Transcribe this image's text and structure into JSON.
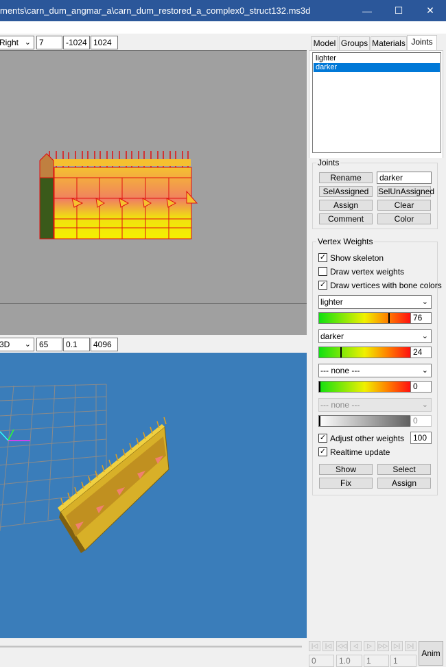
{
  "window": {
    "title": "ments\\carn_dum_angmar_a\\carn_dum_restored_a_complex0_struct132.ms3d",
    "minimize": "—",
    "maximize": "☐",
    "close": "✕"
  },
  "viewport_top": {
    "view": "Right",
    "field1": "7",
    "field2": "-1024",
    "field3": "1024"
  },
  "viewport_bottom": {
    "view": "3D",
    "field1": "65",
    "field2": "0.1",
    "field3": "4096"
  },
  "tabs": [
    "Model",
    "Groups",
    "Materials",
    "Joints"
  ],
  "selected_tab": "Joints",
  "joint_list": [
    "lighter",
    "darker"
  ],
  "selected_joint": "darker",
  "joints_group": {
    "title": "Joints",
    "rename": "Rename",
    "name_value": "darker",
    "sel_assigned": "SelAssigned",
    "sel_unassigned": "SelUnAssigned",
    "assign": "Assign",
    "clear": "Clear",
    "comment": "Comment",
    "color": "Color"
  },
  "vertex_weights": {
    "title": "Vertex Weights",
    "show_skeleton": "Show skeleton",
    "show_skeleton_checked": true,
    "draw_vertex_weights": "Draw vertex weights",
    "draw_vertex_weights_checked": false,
    "draw_vertices_bone_colors": "Draw vertices with bone colors",
    "draw_vertices_bone_colors_checked": true,
    "weights": [
      {
        "joint": "lighter",
        "value": "76",
        "level": 0.76,
        "enabled": true
      },
      {
        "joint": "darker",
        "value": "24",
        "level": 0.24,
        "enabled": true
      },
      {
        "joint": "--- none ---",
        "value": "0",
        "level": 0,
        "enabled": true
      },
      {
        "joint": "--- none ---",
        "value": "0",
        "level": 0,
        "enabled": false
      }
    ],
    "adjust_other_weights": "Adjust other weights",
    "adjust_other_weights_checked": true,
    "adjust_value": "100",
    "realtime_update": "Realtime update",
    "realtime_update_checked": true,
    "show": "Show",
    "select": "Select",
    "fix": "Fix",
    "assign": "Assign"
  },
  "animation": {
    "field1": "0",
    "field2": "1.0",
    "field3": "1",
    "field4": "1",
    "anim_button": "Anim",
    "nav_icons": [
      "skip-start-icon",
      "step-back-end-icon",
      "rewind-icon",
      "prev-icon",
      "play-icon",
      "fast-forward-icon",
      "step-forward-end-icon",
      "skip-end-icon"
    ],
    "nav_glyphs": [
      "|◁",
      "|◁",
      "◁◁",
      "◁",
      "▷",
      "▷▷",
      "▷|",
      "▷|"
    ]
  },
  "colors": {
    "titlebar": "#2b579a",
    "viewport_gray": "#a0a0a0",
    "viewport_blue": "#3a7dba",
    "selection": "#0078d7"
  }
}
